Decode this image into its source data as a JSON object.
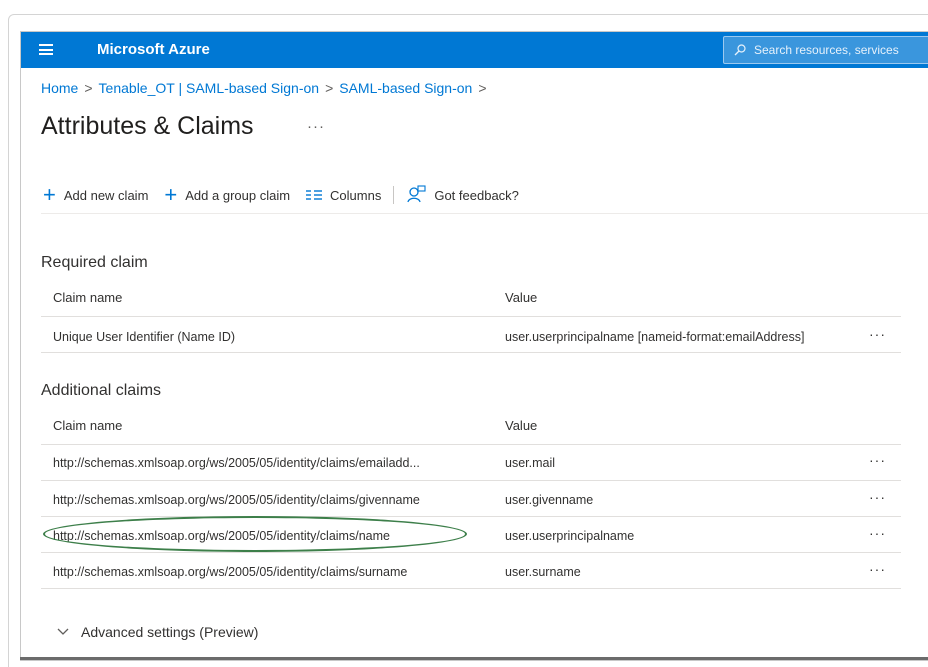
{
  "header": {
    "brand": "Microsoft Azure",
    "search_placeholder": "Search resources, services"
  },
  "breadcrumb": {
    "items": [
      "Home",
      "Tenable_OT | SAML-based Sign-on",
      "SAML-based Sign-on"
    ],
    "separator": ">"
  },
  "page": {
    "title": "Attributes & Claims",
    "more": "···"
  },
  "toolbar": {
    "add_new_claim": "Add new claim",
    "add_group_claim": "Add a group claim",
    "columns": "Columns",
    "feedback": "Got feedback?"
  },
  "required": {
    "title": "Required claim",
    "headers": {
      "name": "Claim name",
      "value": "Value"
    },
    "rows": [
      {
        "name": "Unique User Identifier (Name ID)",
        "value": "user.userprincipalname [nameid-format:emailAddress]"
      }
    ]
  },
  "additional": {
    "title": "Additional claims",
    "headers": {
      "name": "Claim name",
      "value": "Value"
    },
    "rows": [
      {
        "name": "http://schemas.xmlsoap.org/ws/2005/05/identity/claims/emailadd...",
        "value": "user.mail"
      },
      {
        "name": "http://schemas.xmlsoap.org/ws/2005/05/identity/claims/givenname",
        "value": "user.givenname"
      },
      {
        "name": "http://schemas.xmlsoap.org/ws/2005/05/identity/claims/name",
        "value": "user.userprincipalname"
      },
      {
        "name": "http://schemas.xmlsoap.org/ws/2005/05/identity/claims/surname",
        "value": "user.surname"
      }
    ]
  },
  "row_more": "···",
  "advanced": {
    "label": "Advanced settings (Preview)"
  },
  "colors": {
    "accent": "#0078d4",
    "highlight": "#3d7f4a"
  }
}
